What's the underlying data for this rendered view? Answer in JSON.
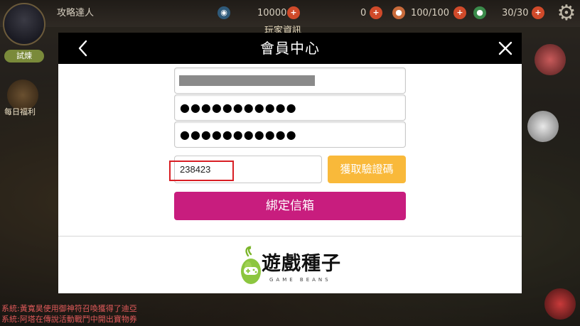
{
  "background": {
    "hud": {
      "player_name": "攻略達人",
      "currency": "10000",
      "diamonds": "0",
      "stamina": "100/100",
      "energy": "30/30",
      "center_label": "玩家資訊"
    },
    "left_button": "試煉",
    "side_label": "每日福利",
    "chat": [
      "系統:黃寬昊使用御神符召喚獲得了迪亞",
      "系統:阿塔在傳說活動戰鬥中開出寶物券"
    ]
  },
  "modal": {
    "title": "會員中心",
    "password_mask": "●●●●●●●●●●●",
    "password_confirm_mask": "●●●●●●●●●●●",
    "verification_code": "238423",
    "get_code_button": "獲取驗證碼",
    "bind_button": "綁定信箱",
    "brand_name": "遊戲種子",
    "brand_subtitle": "GAME BEANS"
  },
  "colors": {
    "get_code_button": "#f9b93a",
    "bind_button": "#c81d7e",
    "highlight": "#d81e24",
    "header": "#000000"
  },
  "icons": {
    "back": "chevron-left-icon",
    "close": "close-icon",
    "logo": "game-beans-mascot-icon"
  }
}
